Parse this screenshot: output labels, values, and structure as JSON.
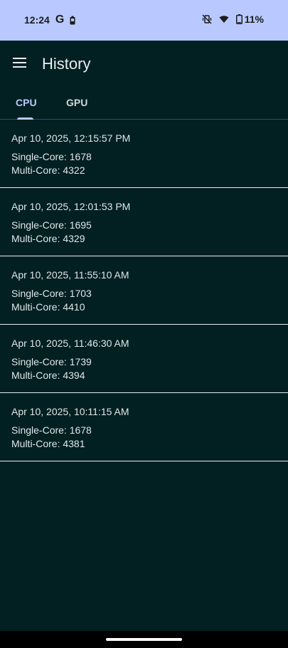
{
  "status_bar": {
    "time": "12:24",
    "google_glyph": "G",
    "battery_percent": "11%",
    "icons": [
      "google-icon",
      "battery-small-icon",
      "vibrate-off-icon",
      "wifi-icon",
      "battery-icon"
    ]
  },
  "app_bar": {
    "title": "History",
    "menu_icon": "menu-icon"
  },
  "tabs": {
    "cpu": "CPU",
    "gpu": "GPU",
    "active": "CPU"
  },
  "history": [
    {
      "date": "Apr 10, 2025, 12:15:57 PM",
      "single": "Single-Core: 1678",
      "multi": "Multi-Core: 4322"
    },
    {
      "date": "Apr 10, 2025, 12:01:53 PM",
      "single": "Single-Core: 1695",
      "multi": "Multi-Core: 4329"
    },
    {
      "date": "Apr 10, 2025, 11:55:10 AM",
      "single": "Single-Core: 1703",
      "multi": "Multi-Core: 4410"
    },
    {
      "date": "Apr 10, 2025, 11:46:30 AM",
      "single": "Single-Core: 1739",
      "multi": "Multi-Core: 4394"
    },
    {
      "date": "Apr 10, 2025, 10:11:15 AM",
      "single": "Single-Core: 1678",
      "multi": "Multi-Core: 4381"
    }
  ],
  "colors": {
    "background": "#021f22",
    "status_bar": "#b9c9ff",
    "accent": "#b9c9ff",
    "text": "#dfe8ea",
    "divider": "#e6eef0"
  }
}
